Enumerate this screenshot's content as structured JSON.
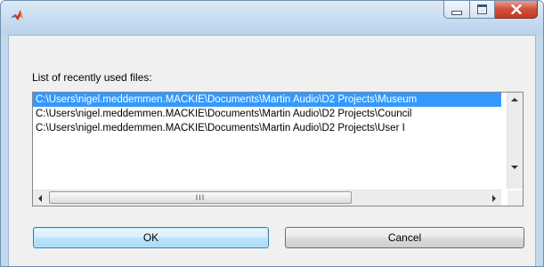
{
  "titlebar": {
    "app_icon": "matlab-icon",
    "controls": {
      "minimize": "minimize-icon",
      "maximize": "maximize-icon",
      "close": "close-icon"
    }
  },
  "dialog": {
    "list_label": "List of recently used files:",
    "files": [
      "C:\\Users\\nigel.meddemmen.MACKIE\\Documents\\Martin Audio\\D2 Projects\\Museum",
      "C:\\Users\\nigel.meddemmen.MACKIE\\Documents\\Martin Audio\\D2 Projects\\Council",
      "C:\\Users\\nigel.meddemmen.MACKIE\\Documents\\Martin Audio\\D2 Projects\\User I"
    ],
    "selected_index": 0,
    "hscroll_grip": "III",
    "ok_label": "OK",
    "cancel_label": "Cancel"
  },
  "colors": {
    "selection": "#3399ff",
    "title_bar": "#c8dcf0",
    "close_button": "#c94530"
  }
}
